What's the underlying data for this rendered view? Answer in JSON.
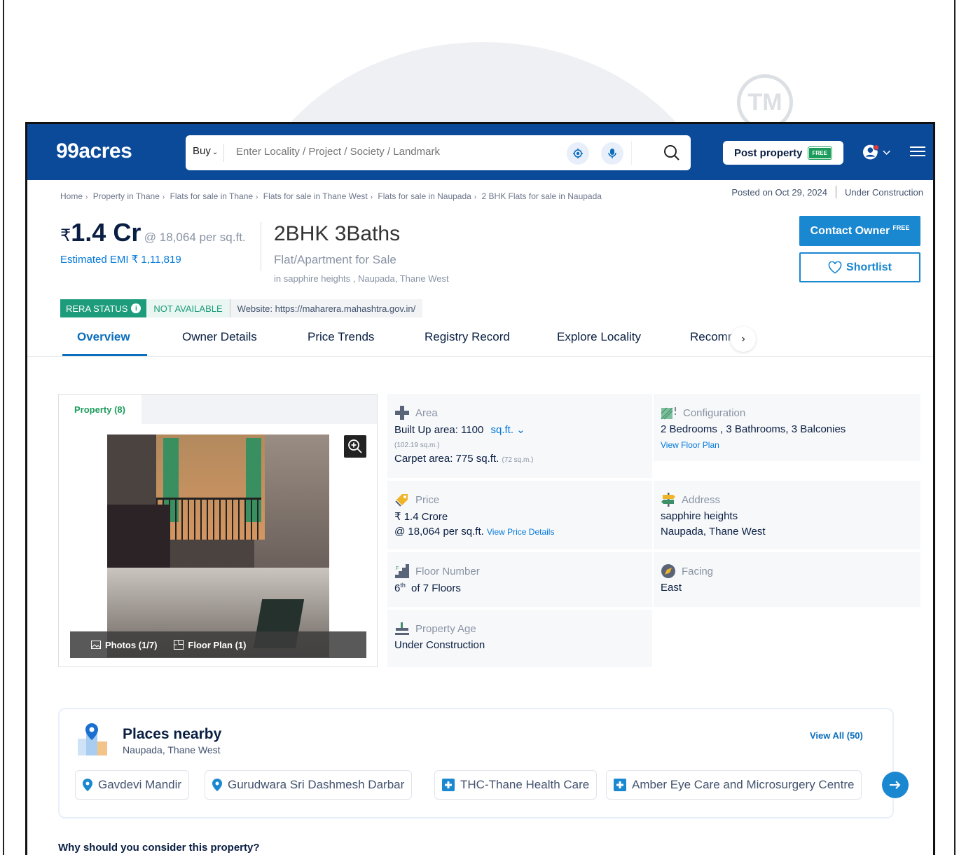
{
  "watermark": {
    "tm": "TM"
  },
  "header": {
    "logo": "99acres",
    "buy_label": "Buy",
    "search_placeholder": "Enter Locality / Project / Society / Landmark",
    "post_property": "Post property",
    "free_tag": "FREE"
  },
  "breadcrumb": [
    "Home",
    "Property in Thane",
    "Flats for sale in Thane",
    "Flats for sale in Thane West",
    "Flats for sale in Naupada",
    "2 BHK Flats for sale in Naupada"
  ],
  "posted": {
    "date": "Posted on Oct 29, 2024",
    "status": "Under Construction"
  },
  "listing": {
    "rupee": "₹",
    "price": "1.4 Cr",
    "per_sqft": "@ 18,064 per sq.ft.",
    "emi": "Estimated EMI ₹ 1,11,819",
    "title": "2BHK 3Baths",
    "subtitle": "Flat/Apartment for Sale",
    "location": "in sapphire heights , Naupada, Thane West"
  },
  "actions": {
    "contact": "Contact Owner",
    "contact_free": "FREE",
    "shortlist": "Shortlist"
  },
  "rera": {
    "badge": "RERA STATUS",
    "info": "i",
    "status": "NOT AVAILABLE",
    "website": "Website: https://maharera.mahashtra.gov.in/"
  },
  "tabs": [
    "Overview",
    "Owner Details",
    "Price Trends",
    "Registry Record",
    "Explore Locality",
    "Recomm"
  ],
  "gallery": {
    "tab": "Property (8)",
    "photos": "Photos (1/7)",
    "floor_plan": "Floor Plan (1)"
  },
  "details": {
    "area": {
      "label": "Area",
      "built_up": "Built Up area: 1100",
      "unit": "sq.ft.",
      "built_up_sqm": "(102.19 sq.m.)",
      "carpet": "Carpet area: 775 sq.ft.",
      "carpet_sqm": "(72 sq.m.)"
    },
    "configuration": {
      "label": "Configuration",
      "value": "2 Bedrooms , 3 Bathrooms, 3 Balconies",
      "link": "View Floor Plan"
    },
    "price": {
      "label": "Price",
      "value": "₹ 1.4 Crore",
      "per_sqft": "@ 18,064 per sq.ft.",
      "link": "View Price Details"
    },
    "address": {
      "label": "Address",
      "line1": "sapphire heights",
      "line2": "Naupada, Thane West"
    },
    "floor": {
      "label": "Floor Number",
      "floor": "6",
      "suffix": "th",
      "of": "of 7 Floors"
    },
    "facing": {
      "label": "Facing",
      "value": "East"
    },
    "age": {
      "label": "Property Age",
      "value": "Under Construction"
    }
  },
  "places": {
    "title": "Places nearby",
    "subtitle": "Naupada, Thane West",
    "view_all": "View All (50)",
    "chips": [
      "Gavdevi Mandir",
      "Gurudwara Sri Dashmesh Darbar",
      "THC-Thane Health Care",
      "Amber Eye Care and Microsurgery Centre"
    ]
  },
  "why": "Why should you consider this property?",
  "colors": {
    "header_blue": "#0a4a99",
    "primary_blue": "#1a87d1",
    "green": "#1c9c5b",
    "rera_green": "#1c9c7b"
  }
}
